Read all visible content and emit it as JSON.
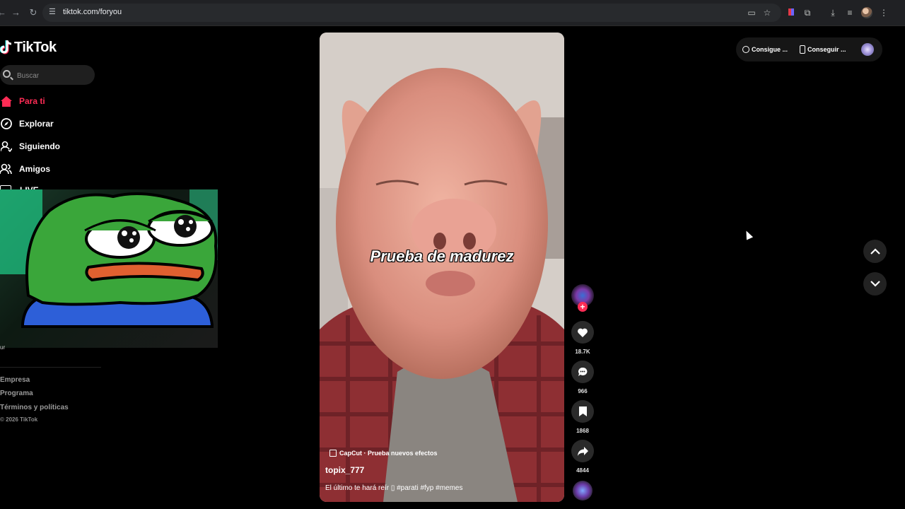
{
  "browser": {
    "url": "tiktok.com/foryou"
  },
  "sidebar": {
    "logo_text": "TikTok",
    "search_placeholder": "Buscar",
    "items": [
      {
        "label": "Para ti",
        "icon": "home-icon",
        "active": true
      },
      {
        "label": "Explorar",
        "icon": "compass-icon",
        "active": false
      },
      {
        "label": "Siguiendo",
        "icon": "following-icon",
        "active": false
      },
      {
        "label": "Amigos",
        "icon": "friends-icon",
        "active": false
      }
    ],
    "live_label": "LIVE",
    "footer": {
      "empresa": "Empresa",
      "programa": "Programa",
      "terminos": "Términos y políticas",
      "copyright": "© 2026 TikTok"
    },
    "partial_text": "ur"
  },
  "video": {
    "overlay_title": "Prueba de madurez",
    "effect_label": "CapCut · Prueba nuevos efectos",
    "username": "topix_777",
    "description": "El último te hará reír ▯ #parati #fyp #memes"
  },
  "actions": {
    "likes": "18.7K",
    "comments": "966",
    "saves": "1868",
    "shares": "4844"
  },
  "top_right": {
    "btn1": "Consigue ...",
    "btn2": "Conseguir ..."
  },
  "colors": {
    "accent": "#fe2c55",
    "background": "#000000"
  }
}
